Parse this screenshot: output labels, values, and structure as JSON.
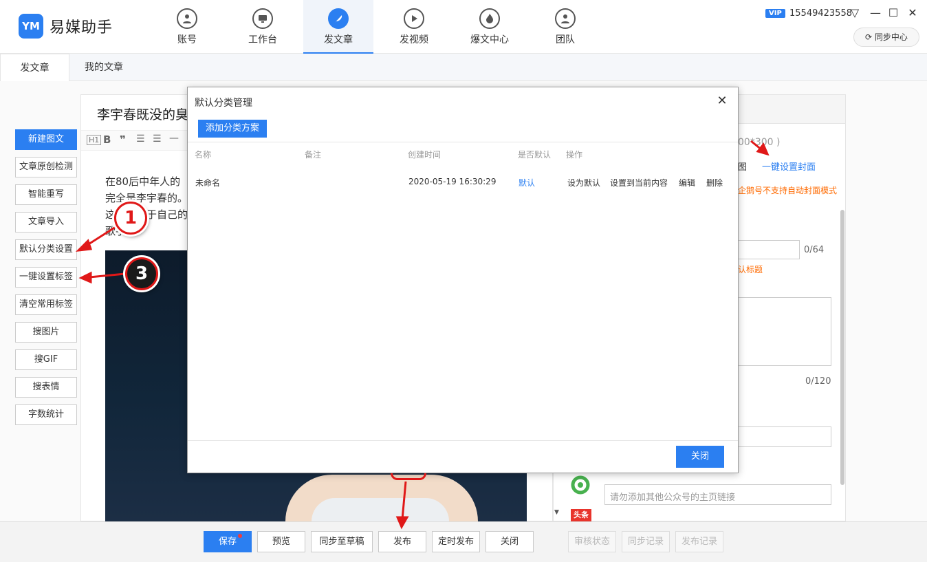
{
  "app": {
    "name": "易媒助手",
    "logo_text": "YM"
  },
  "nav": [
    {
      "label": "账号",
      "icon": "user-icon"
    },
    {
      "label": "工作台",
      "icon": "monitor-icon"
    },
    {
      "label": "发文章",
      "icon": "feather-icon",
      "active": true
    },
    {
      "label": "发视频",
      "icon": "play-icon"
    },
    {
      "label": "爆文中心",
      "icon": "fire-icon"
    },
    {
      "label": "团队",
      "icon": "team-icon"
    }
  ],
  "account": {
    "vip": "VIP",
    "phone": "15549423558",
    "sync_center": "同步中心"
  },
  "subtabs": [
    "发文章",
    "我的文章"
  ],
  "sidebar": [
    "新建图文",
    "文章原创检测",
    "智能重写",
    "文章导入",
    "默认分类设置",
    "一键设置标签",
    "清空常用标签",
    "搜图片",
    "搜GIF",
    "搜表情",
    "字数统计"
  ],
  "editor": {
    "title": "李宇春既没的臭",
    "para1": "在80后中年人的",
    "para2": "完全是李宇春的。",
    "para3": "这了以月于自己的",
    "para4": "歌手"
  },
  "right_panel": {
    "size_hint": "00*300 )",
    "cover_tail": "图",
    "one_click_cover": "一键设置封面",
    "warning": "企鹅号不支持自动封面模式",
    "title_count": "0/64",
    "title_hint": "认标题",
    "summary_count": "0/120",
    "homepage_placeholder": "请勿添加其他公众号的主页链接"
  },
  "bottom": {
    "save": "保存",
    "preview": "预览",
    "sync_draft": "同步至草稿",
    "publish": "发布",
    "schedule": "定时发布",
    "close": "关闭",
    "review": "审核状态",
    "sync_log": "同步记录",
    "publish_log": "发布记录"
  },
  "modal": {
    "title": "默认分类管理",
    "add_button": "添加分类方案",
    "columns": [
      "名称",
      "备注",
      "创建时间",
      "是否默认",
      "操作"
    ],
    "row": {
      "name": "未命名",
      "note": "",
      "created": "2020-05-19 16:30:29",
      "default": "默认",
      "actions": [
        "设为默认",
        "设置到当前内容",
        "编辑",
        "删除"
      ]
    },
    "close_button": "关闭"
  },
  "annotations": {
    "one": "1",
    "three": "3"
  },
  "colors": {
    "accent": "#2b7ff1",
    "warning": "#ff6a00",
    "annotation": "#e01818"
  }
}
